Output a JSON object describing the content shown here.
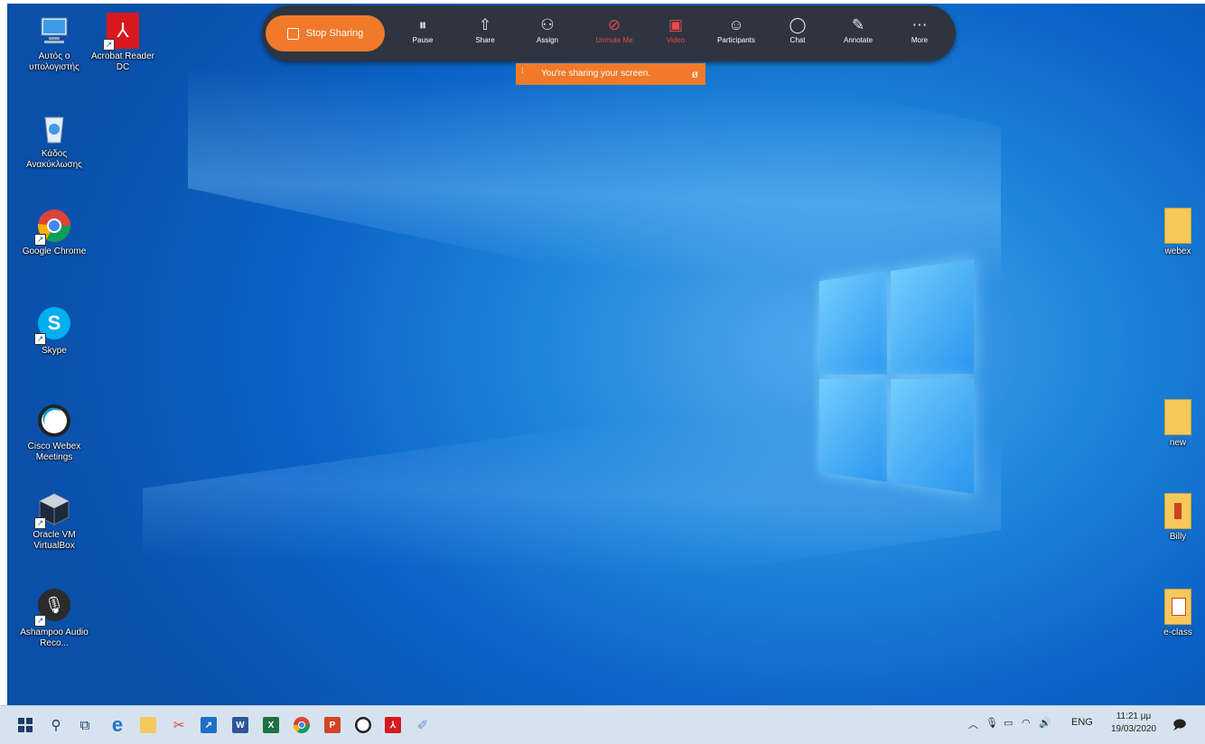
{
  "toolbar": {
    "stop_sharing": "Stop Sharing",
    "buttons": [
      {
        "label": "Pause",
        "icon": "pause-icon"
      },
      {
        "label": "Share",
        "icon": "share-icon"
      },
      {
        "label": "Assign",
        "icon": "assign-icon"
      },
      {
        "label": "Unmute Me",
        "icon": "microphone-muted-icon"
      },
      {
        "label": "Video",
        "icon": "video-off-icon"
      },
      {
        "label": "Participants",
        "icon": "participants-icon"
      },
      {
        "label": "Chat",
        "icon": "chat-icon"
      },
      {
        "label": "Annotate",
        "icon": "annotate-icon"
      },
      {
        "label": "More",
        "icon": "more-icon"
      }
    ],
    "banner": "You're sharing your screen."
  },
  "desktop": {
    "left_icons": [
      {
        "label": "Αυτός ο υπολογιστής"
      },
      {
        "label": "Acrobat Reader DC"
      },
      {
        "label": "Κάδος Ανακύκλωσης"
      },
      {
        "label": "Google Chrome"
      },
      {
        "label": "Skype"
      },
      {
        "label": "Cisco Webex Meetings"
      },
      {
        "label": "Oracle VM VirtualBox"
      },
      {
        "label": "Ashampoo Audio Reco..."
      }
    ],
    "right_icons": [
      {
        "label": "webex"
      },
      {
        "label": "new"
      },
      {
        "label": "Billy"
      },
      {
        "label": "e-class"
      }
    ]
  },
  "taskbar": {
    "language": "ENG",
    "time": "11:21 μμ",
    "date": "19/03/2020"
  },
  "colors": {
    "accent_orange": "#f07a2a",
    "toolbar_bg": "#2e3440",
    "muted_red": "#e8494b",
    "taskbar_bg": "#d6e3ef"
  }
}
